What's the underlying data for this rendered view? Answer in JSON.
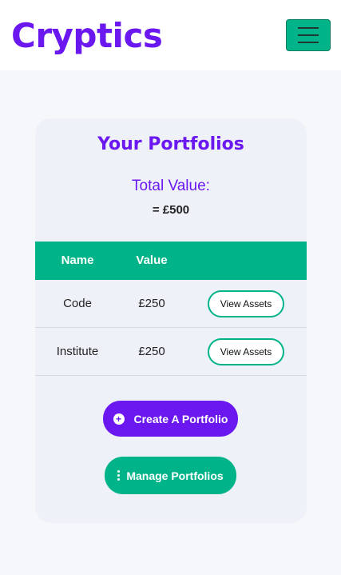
{
  "header": {
    "brand": "Cryptics",
    "menu_icon": "hamburger-icon"
  },
  "portfolio": {
    "title": "Your Portfolios",
    "total_label": "Total Value:",
    "total_value": "= £500",
    "columns": [
      "Name",
      "Value"
    ],
    "rows": [
      {
        "name": "Code",
        "value": "£250",
        "action": "View Assets"
      },
      {
        "name": "Institute",
        "value": "£250",
        "action": "View Assets"
      }
    ]
  },
  "actions": {
    "create_label": "Create A Portfolio",
    "create_icon": "plus-circle-icon",
    "manage_label": "Manage Portfolios",
    "manage_icon": "vertical-dots-icon"
  },
  "colors": {
    "brand": "#6a17f0",
    "accent": "#00b389",
    "card_bg": "#eef1f8"
  }
}
